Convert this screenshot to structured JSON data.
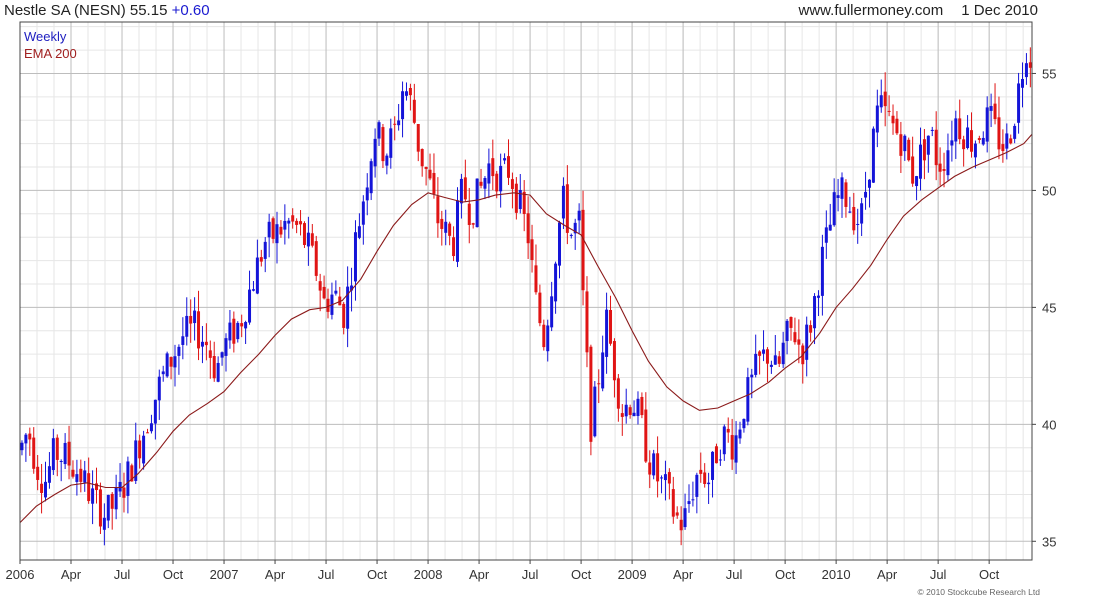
{
  "header": {
    "symbol": "Nestle SA (NESN)",
    "price": "55.15",
    "change": "+0.60",
    "website": "www.fullermoney.com",
    "date": "1 Dec 2010"
  },
  "legend": {
    "weekly": "Weekly",
    "ema": "EMA 200"
  },
  "copyright": "© 2010 Stockcube Research Ltd",
  "colors": {
    "up": "#1414d8",
    "down": "#e01414",
    "ema": "#8b1a1a",
    "weekly_label": "#2020c0",
    "ema_label": "#a02020",
    "grid_major": "#bdbdbd",
    "grid_minor": "#e6e6e6"
  },
  "chart_data": {
    "type": "candlestick",
    "frequency": "weekly",
    "ylim": [
      34.2,
      57.2
    ],
    "yticks": [
      35,
      40,
      45,
      50,
      55
    ],
    "x_range": [
      2006.0,
      2010.96
    ],
    "xtick_labels": [
      {
        "t": 2006.0,
        "label": "2006"
      },
      {
        "t": 2006.25,
        "label": "Apr"
      },
      {
        "t": 2006.5,
        "label": "Jul"
      },
      {
        "t": 2006.75,
        "label": "Oct"
      },
      {
        "t": 2007.0,
        "label": "2007"
      },
      {
        "t": 2007.25,
        "label": "Apr"
      },
      {
        "t": 2007.5,
        "label": "Jul"
      },
      {
        "t": 2007.75,
        "label": "Oct"
      },
      {
        "t": 2008.0,
        "label": "2008"
      },
      {
        "t": 2008.25,
        "label": "Apr"
      },
      {
        "t": 2008.5,
        "label": "Jul"
      },
      {
        "t": 2008.75,
        "label": "Oct"
      },
      {
        "t": 2009.0,
        "label": "2009"
      },
      {
        "t": 2009.25,
        "label": "Apr"
      },
      {
        "t": 2009.5,
        "label": "Jul"
      },
      {
        "t": 2009.75,
        "label": "Oct"
      },
      {
        "t": 2010.0,
        "label": "2010"
      },
      {
        "t": 2010.25,
        "label": "Apr"
      },
      {
        "t": 2010.5,
        "label": "Jul"
      },
      {
        "t": 2010.75,
        "label": "Oct"
      }
    ],
    "price_path": [
      [
        2006.0,
        38.9
      ],
      [
        2006.04,
        39.8
      ],
      [
        2006.08,
        38.3
      ],
      [
        2006.12,
        37.5
      ],
      [
        2006.17,
        38.8
      ],
      [
        2006.22,
        38.6
      ],
      [
        2006.3,
        37.8
      ],
      [
        2006.35,
        36.9
      ],
      [
        2006.42,
        36.1
      ],
      [
        2006.47,
        36.7
      ],
      [
        2006.52,
        37.6
      ],
      [
        2006.6,
        39.6
      ],
      [
        2006.68,
        41.6
      ],
      [
        2006.73,
        42.6
      ],
      [
        2006.8,
        43.8
      ],
      [
        2006.86,
        44.1
      ],
      [
        2006.92,
        43.4
      ],
      [
        2006.96,
        42.3
      ],
      [
        2007.0,
        43.3
      ],
      [
        2007.08,
        44.4
      ],
      [
        2007.14,
        46.1
      ],
      [
        2007.2,
        47.8
      ],
      [
        2007.26,
        48.2
      ],
      [
        2007.31,
        48.6
      ],
      [
        2007.36,
        48.4
      ],
      [
        2007.41,
        47.6
      ],
      [
        2007.46,
        46.4
      ],
      [
        2007.49,
        45.2
      ],
      [
        2007.54,
        45.6
      ],
      [
        2007.59,
        44.7
      ],
      [
        2007.64,
        47.6
      ],
      [
        2007.7,
        50.6
      ],
      [
        2007.74,
        52.6
      ],
      [
        2007.79,
        51.6
      ],
      [
        2007.84,
        52.6
      ],
      [
        2007.88,
        54.6
      ],
      [
        2007.92,
        53.6
      ],
      [
        2007.96,
        51.6
      ],
      [
        2008.0,
        50.6
      ],
      [
        2008.04,
        48.9
      ],
      [
        2008.08,
        48.3
      ],
      [
        2008.12,
        47.6
      ],
      [
        2008.17,
        50.1
      ],
      [
        2008.21,
        49.1
      ],
      [
        2008.26,
        50.1
      ],
      [
        2008.3,
        51.1
      ],
      [
        2008.35,
        50.6
      ],
      [
        2008.4,
        50.9
      ],
      [
        2008.44,
        49.6
      ],
      [
        2008.49,
        48.1
      ],
      [
        2008.53,
        45.1
      ],
      [
        2008.57,
        43.6
      ],
      [
        2008.62,
        47.1
      ],
      [
        2008.66,
        49.6
      ],
      [
        2008.7,
        48.1
      ],
      [
        2008.74,
        48.6
      ],
      [
        2008.77,
        43.6
      ],
      [
        2008.8,
        39.8
      ],
      [
        2008.83,
        41.6
      ],
      [
        2008.87,
        44.6
      ],
      [
        2008.91,
        42.6
      ],
      [
        2008.95,
        40.6
      ],
      [
        2009.0,
        41.1
      ],
      [
        2009.04,
        40.1
      ],
      [
        2009.08,
        38.6
      ],
      [
        2009.13,
        37.6
      ],
      [
        2009.17,
        37.1
      ],
      [
        2009.21,
        36.1
      ],
      [
        2009.25,
        35.7
      ],
      [
        2009.29,
        37.1
      ],
      [
        2009.33,
        38.1
      ],
      [
        2009.38,
        37.6
      ],
      [
        2009.42,
        39.1
      ],
      [
        2009.46,
        39.6
      ],
      [
        2009.5,
        39.1
      ],
      [
        2009.54,
        40.6
      ],
      [
        2009.58,
        41.6
      ],
      [
        2009.62,
        42.6
      ],
      [
        2009.67,
        43.1
      ],
      [
        2009.71,
        42.1
      ],
      [
        2009.75,
        43.6
      ],
      [
        2009.79,
        44.1
      ],
      [
        2009.83,
        43.1
      ],
      [
        2009.87,
        44.1
      ],
      [
        2009.92,
        46.6
      ],
      [
        2009.96,
        48.1
      ],
      [
        2010.0,
        49.6
      ],
      [
        2010.04,
        49.9
      ],
      [
        2010.08,
        49.1
      ],
      [
        2010.12,
        48.6
      ],
      [
        2010.17,
        51.6
      ],
      [
        2010.21,
        53.6
      ],
      [
        2010.25,
        53.1
      ],
      [
        2010.29,
        52.6
      ],
      [
        2010.33,
        52.1
      ],
      [
        2010.37,
        50.6
      ],
      [
        2010.42,
        51.6
      ],
      [
        2010.46,
        52.6
      ],
      [
        2010.5,
        51.1
      ],
      [
        2010.54,
        51.6
      ],
      [
        2010.58,
        53.1
      ],
      [
        2010.62,
        52.6
      ],
      [
        2010.67,
        52.1
      ],
      [
        2010.71,
        52.6
      ],
      [
        2010.75,
        53.1
      ],
      [
        2010.79,
        52.3
      ],
      [
        2010.83,
        51.8
      ],
      [
        2010.87,
        53.1
      ],
      [
        2010.91,
        55.1
      ],
      [
        2010.94,
        56.6
      ],
      [
        2010.96,
        55.15
      ]
    ],
    "ema200": [
      [
        2006.0,
        35.8
      ],
      [
        2006.08,
        36.5
      ],
      [
        2006.17,
        37.0
      ],
      [
        2006.25,
        37.4
      ],
      [
        2006.33,
        37.5
      ],
      [
        2006.42,
        37.3
      ],
      [
        2006.5,
        37.3
      ],
      [
        2006.58,
        37.9
      ],
      [
        2006.67,
        38.8
      ],
      [
        2006.75,
        39.7
      ],
      [
        2006.83,
        40.4
      ],
      [
        2006.92,
        40.9
      ],
      [
        2007.0,
        41.4
      ],
      [
        2007.08,
        42.2
      ],
      [
        2007.17,
        43.0
      ],
      [
        2007.25,
        43.8
      ],
      [
        2007.33,
        44.5
      ],
      [
        2007.42,
        44.9
      ],
      [
        2007.5,
        45.0
      ],
      [
        2007.58,
        45.3
      ],
      [
        2007.67,
        46.2
      ],
      [
        2007.75,
        47.4
      ],
      [
        2007.83,
        48.5
      ],
      [
        2007.92,
        49.4
      ],
      [
        2008.0,
        49.9
      ],
      [
        2008.08,
        49.7
      ],
      [
        2008.17,
        49.5
      ],
      [
        2008.25,
        49.6
      ],
      [
        2008.33,
        49.8
      ],
      [
        2008.42,
        49.9
      ],
      [
        2008.5,
        49.8
      ],
      [
        2008.58,
        49.0
      ],
      [
        2008.67,
        48.5
      ],
      [
        2008.75,
        48.1
      ],
      [
        2008.83,
        46.8
      ],
      [
        2008.92,
        45.4
      ],
      [
        2009.0,
        44.0
      ],
      [
        2009.08,
        42.7
      ],
      [
        2009.17,
        41.6
      ],
      [
        2009.25,
        41.0
      ],
      [
        2009.33,
        40.6
      ],
      [
        2009.42,
        40.7
      ],
      [
        2009.5,
        41.0
      ],
      [
        2009.58,
        41.3
      ],
      [
        2009.67,
        41.8
      ],
      [
        2009.75,
        42.4
      ],
      [
        2009.83,
        42.9
      ],
      [
        2009.92,
        43.9
      ],
      [
        2010.0,
        45.0
      ],
      [
        2010.08,
        45.8
      ],
      [
        2010.17,
        46.8
      ],
      [
        2010.25,
        47.9
      ],
      [
        2010.33,
        48.9
      ],
      [
        2010.42,
        49.6
      ],
      [
        2010.5,
        50.1
      ],
      [
        2010.58,
        50.6
      ],
      [
        2010.67,
        51.0
      ],
      [
        2010.75,
        51.3
      ],
      [
        2010.83,
        51.6
      ],
      [
        2010.92,
        52.0
      ],
      [
        2010.96,
        52.4
      ]
    ]
  }
}
